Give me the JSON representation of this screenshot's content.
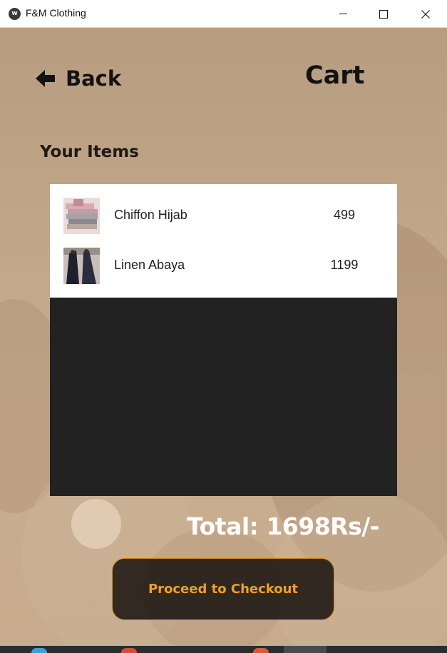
{
  "window": {
    "title": "F&M Clothing",
    "icon": "app-logo-icon",
    "controls": [
      "minimize-icon",
      "maximize-icon",
      "close-icon"
    ]
  },
  "header": {
    "back_label": "Back",
    "back_icon": "arrow-left-icon",
    "title": "Cart"
  },
  "section_label": "Your Items",
  "cart": {
    "items": [
      {
        "name": "Chiffon Hijab",
        "price": "499",
        "thumb": "hijab-photo"
      },
      {
        "name": "Linen Abaya",
        "price": "1199",
        "thumb": "abaya-photo"
      }
    ]
  },
  "total_label": "Total: 1698Rs/-",
  "checkout_label": "Proceed to Checkout",
  "colors": {
    "panel": "#222222",
    "accent": "#f0a020",
    "button_border": "#c8881a",
    "background": "#c4a888"
  }
}
